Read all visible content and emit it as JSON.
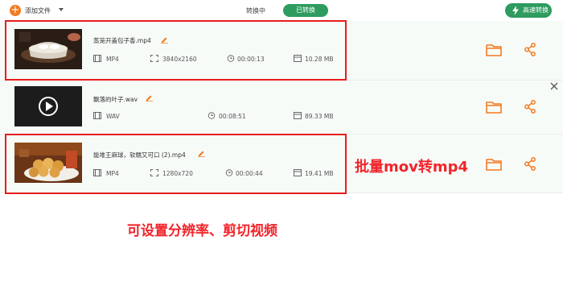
{
  "toolbar": {
    "add_files_label": "添加文件",
    "tab_converting": "转换中",
    "tab_converted": "已转换",
    "fast_convert_label": "高速转换"
  },
  "files": [
    {
      "name": "蒸笼开盖包子香.mp4",
      "format": "MP4",
      "resolution": "3840x2160",
      "duration": "00:00:13",
      "size": "10.28 MB"
    },
    {
      "name": "飘落的叶子.wav",
      "format": "WAV",
      "duration": "00:08:51",
      "size": "89.33 MB"
    },
    {
      "name": "能堆王麻球，软糯又可口 (2).mp4",
      "format": "MP4",
      "resolution": "1280x720",
      "duration": "00:00:44",
      "size": "19.41 MB"
    }
  ],
  "annotations": {
    "batch": "批量mov转mp4",
    "settings": "可设置分辨率、剪切视频"
  },
  "colors": {
    "accent": "#f47a20",
    "green": "#2e9b5f",
    "red": "#e81d1d",
    "row_bg": "#f7fbf8"
  }
}
